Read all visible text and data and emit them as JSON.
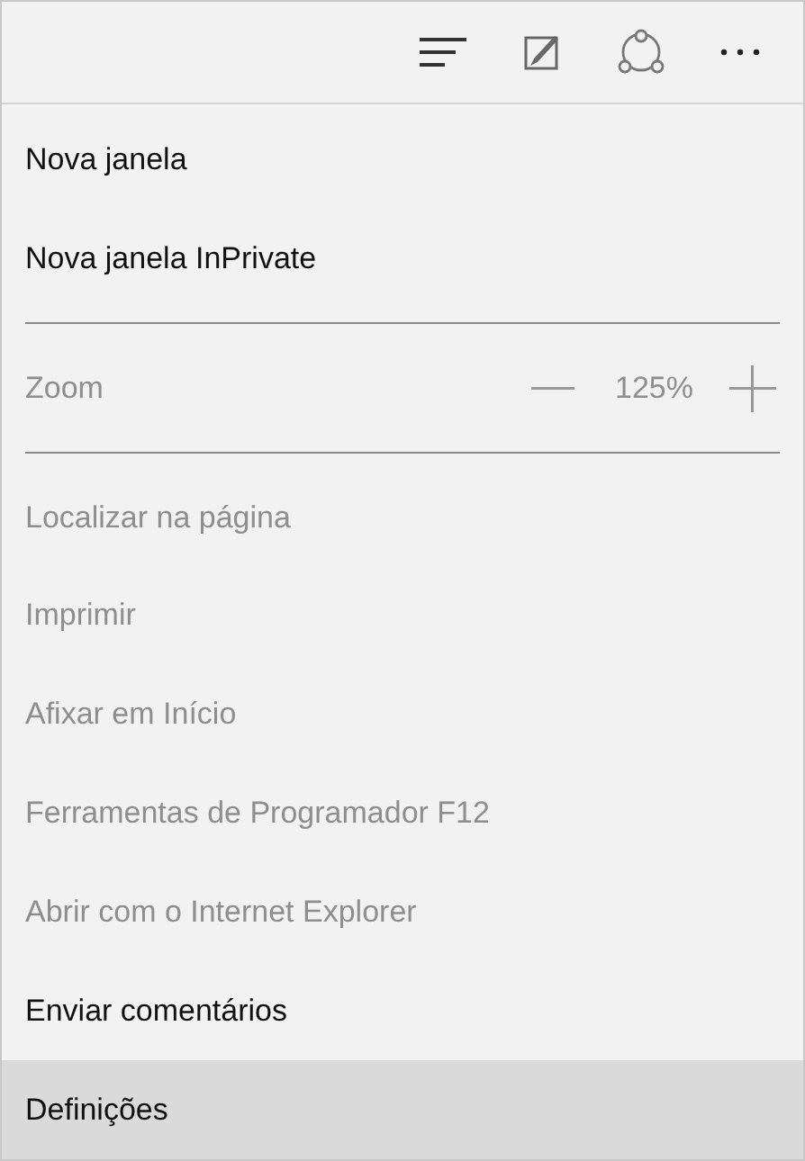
{
  "toolbar": {
    "buttons": [
      {
        "kind": "hub"
      },
      {
        "kind": "note"
      },
      {
        "kind": "share"
      },
      {
        "kind": "more"
      }
    ]
  },
  "menu": [
    {
      "kind": "item",
      "label": "Nova janela",
      "disabled": false,
      "selected": false
    },
    {
      "kind": "item",
      "label": "Nova janela InPrivate",
      "disabled": false,
      "selected": false
    },
    {
      "kind": "divider"
    },
    {
      "kind": "zoom",
      "label": "Zoom",
      "value": "125%",
      "disabled": true
    },
    {
      "kind": "divider"
    },
    {
      "kind": "item",
      "label": "Localizar na página",
      "disabled": true,
      "selected": false
    },
    {
      "kind": "item",
      "label": "Imprimir",
      "disabled": true,
      "selected": false
    },
    {
      "kind": "item",
      "label": "Afixar em Início",
      "disabled": true,
      "selected": false
    },
    {
      "kind": "item",
      "label": "Ferramentas de Programador F12",
      "disabled": true,
      "selected": false
    },
    {
      "kind": "item",
      "label": "Abrir com o Internet Explorer",
      "disabled": true,
      "selected": false
    },
    {
      "kind": "item",
      "label": "Enviar comentários",
      "disabled": false,
      "selected": false
    },
    {
      "kind": "item",
      "label": "Definições",
      "disabled": false,
      "selected": true
    }
  ]
}
